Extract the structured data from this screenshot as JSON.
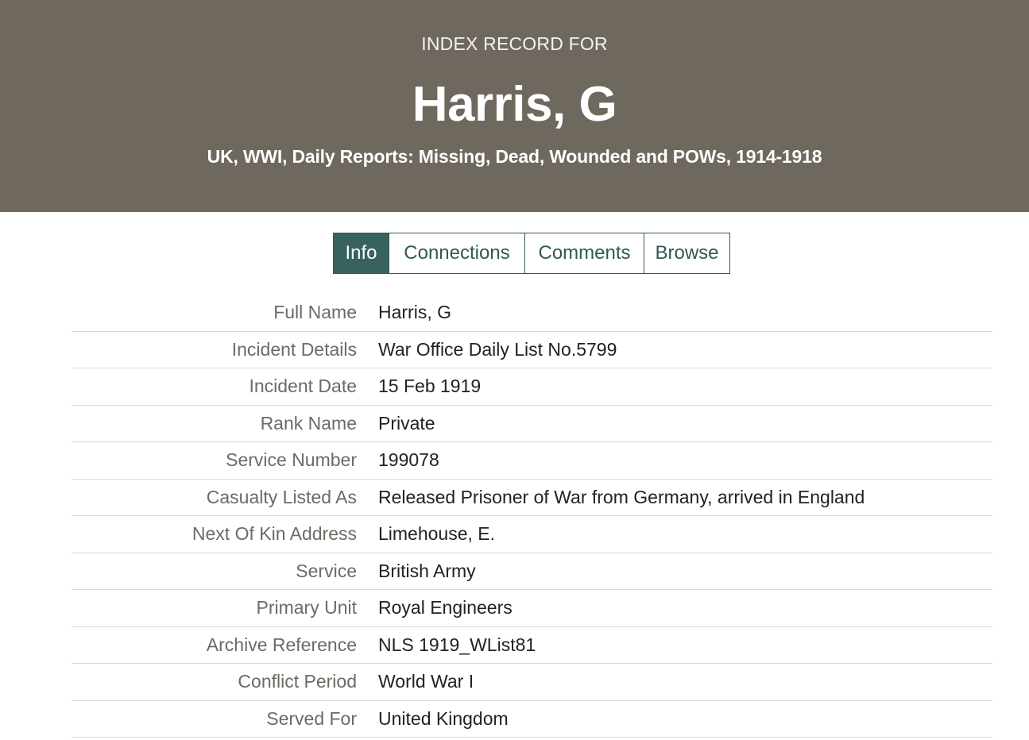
{
  "header": {
    "kicker": "INDEX RECORD FOR",
    "title": "Harris, G",
    "collection": "UK, WWI, Daily Reports: Missing, Dead, Wounded and POWs, 1914-1918",
    "background_color": "#6e685f"
  },
  "tabs": [
    {
      "label": "Info",
      "active": true
    },
    {
      "label": "Connections",
      "active": false
    },
    {
      "label": "Comments",
      "active": false
    },
    {
      "label": "Browse",
      "active": false
    }
  ],
  "accent_color": "#38625f",
  "details": [
    {
      "label": "Full Name",
      "value": "Harris, G"
    },
    {
      "label": "Incident Details",
      "value": "War Office Daily List No.5799"
    },
    {
      "label": "Incident Date",
      "value": "15 Feb 1919"
    },
    {
      "label": "Rank Name",
      "value": "Private"
    },
    {
      "label": "Service Number",
      "value": "199078"
    },
    {
      "label": "Casualty Listed As",
      "value": "Released Prisoner of War from Germany, arrived in England"
    },
    {
      "label": "Next Of Kin Address",
      "value": "Limehouse, E."
    },
    {
      "label": "Service",
      "value": "British Army"
    },
    {
      "label": "Primary Unit",
      "value": "Royal Engineers"
    },
    {
      "label": "Archive Reference",
      "value": "NLS 1919_WList81"
    },
    {
      "label": "Conflict Period",
      "value": "World War I"
    },
    {
      "label": "Served For",
      "value": "United Kingdom"
    }
  ]
}
